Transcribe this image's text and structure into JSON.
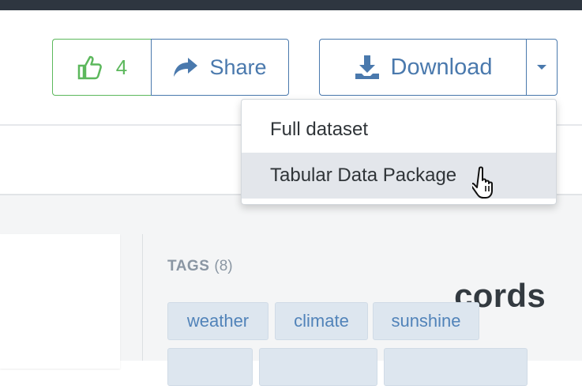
{
  "toolbar": {
    "like_count": "4",
    "share_label": "Share",
    "download_label": "Download"
  },
  "download_menu": {
    "items": [
      {
        "label": "Full dataset",
        "highlighted": false
      },
      {
        "label": "Tabular Data Package",
        "highlighted": true
      }
    ]
  },
  "dataset": {
    "title_fragment": "cords"
  },
  "tags": {
    "heading": "TAGS",
    "count": "(8)",
    "items": [
      "weather",
      "climate",
      "sunshine"
    ]
  },
  "colors": {
    "like_green": "#5cb85c",
    "primary_blue": "#4a79ad",
    "tag_bg": "#dde6ef",
    "topbar": "#2e3640"
  }
}
